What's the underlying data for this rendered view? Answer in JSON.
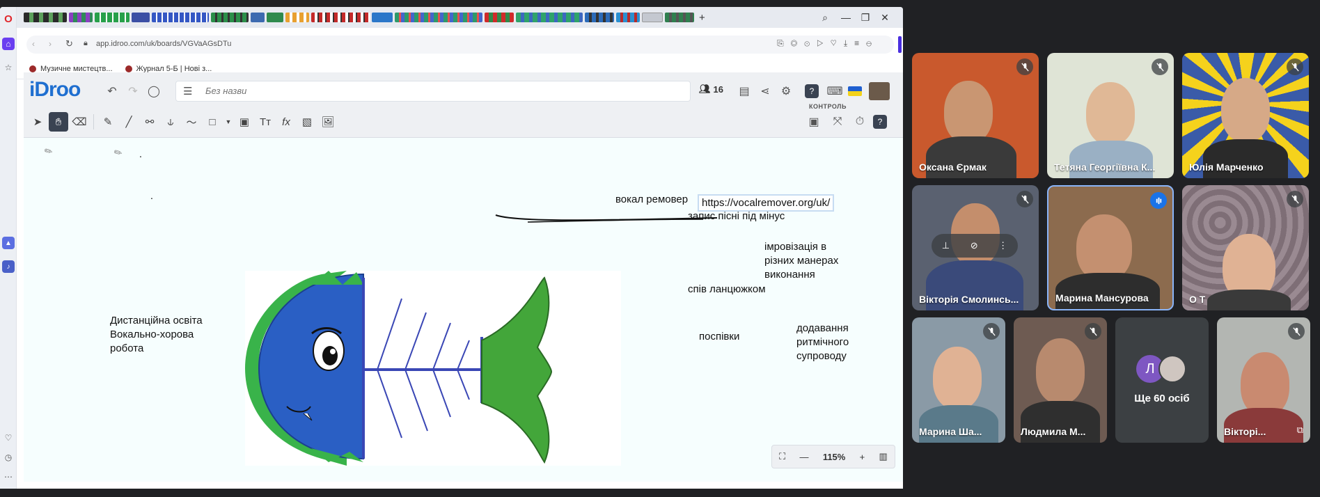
{
  "browser": {
    "url": "app.idroo.com/uk/boards/VGVaAGsDTu",
    "bookmarks": [
      "Музичне мистецтв...",
      "Журнал 5-Б | Нові з..."
    ]
  },
  "app": {
    "logo": "iDroo",
    "participants_count": "16",
    "title_placeholder": "Без назви",
    "control_label": "КОНТРОЛЬ",
    "zoom": "115%"
  },
  "canvas": {
    "vocal_remover": "вокал ремовер",
    "url_note": "https://vocalremover.org/uk/",
    "record_song": "запис пісні під мінус",
    "improv": "імровізація в\nрізних манерах\nвиконання",
    "chain_singing": "спів ланцюжком",
    "distance_ed": "Дистанційна освіта\nВокально-хорова\nробота",
    "pospivky": "поспівки",
    "rhythm": "додавання\nритмічного\nсупроводу"
  },
  "meet": {
    "tiles": [
      {
        "name": "Оксана Єрмак",
        "bg": "#c9592d",
        "muted": true
      },
      {
        "name": "Тетяна Георгіївна К...",
        "bg": "#dfe4d6",
        "muted": true
      },
      {
        "name": "Юлія Марченко",
        "bg": "#3a5ba8",
        "muted": true
      },
      {
        "name": "Вікторія Смолинсь...",
        "bg": "#5a6170",
        "muted": true
      },
      {
        "name": "Марина Мансурова",
        "bg": "#8c6b4e",
        "muted": false
      },
      {
        "name": "О Т",
        "bg": "#8e7e86",
        "muted": true
      },
      {
        "name": "Марина Ша...",
        "bg": "#8a9aa6",
        "muted": true
      },
      {
        "name": "Людмила М...",
        "bg": "#6e5b52",
        "muted": true
      },
      {
        "name": "Вікторі...",
        "bg": "#b3b6b2",
        "muted": true
      }
    ],
    "others_initial": "Л",
    "others_label": "Ще 60 осіб"
  }
}
